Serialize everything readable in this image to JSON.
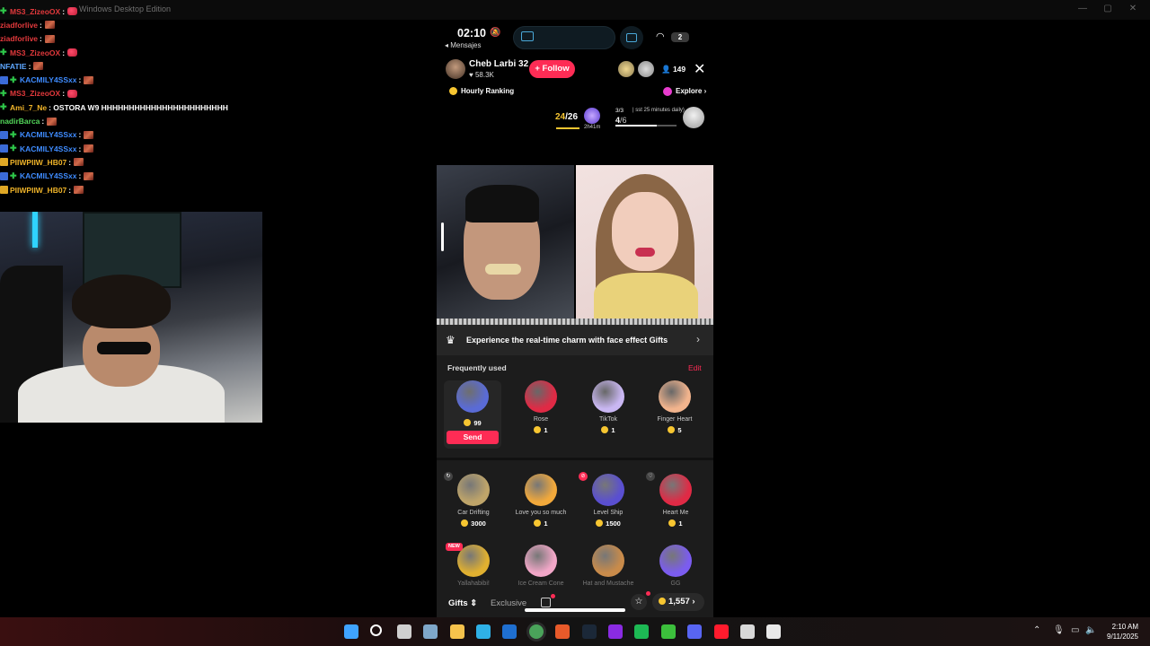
{
  "window": {
    "title": "Windows Desktop Edition"
  },
  "chat": [
    {
      "user": "MS3_ZizeoOX",
      "color": "#e3393c",
      "badge": "green",
      "text": ":",
      "emote": "heart"
    },
    {
      "user": "ziadforlive",
      "color": "#e3393c",
      "badge": "",
      "text": ":",
      "emote": "face"
    },
    {
      "user": "ziadforlive",
      "color": "#e3393c",
      "badge": "",
      "text": ":",
      "emote": "face"
    },
    {
      "user": "MS3_ZizeoOX",
      "color": "#e3393c",
      "badge": "green",
      "text": ":",
      "emote": "heart"
    },
    {
      "user": "NFATIE",
      "color": "#5ea7ff",
      "badge": "",
      "text": ":",
      "emote": "face"
    },
    {
      "user": "KACMILY4SSxx",
      "color": "#3f8cff",
      "badge": "blue",
      "text": ":",
      "emote": "face"
    },
    {
      "user": "MS3_ZizeoOX",
      "color": "#e3393c",
      "badge": "green",
      "text": ":",
      "emote": "heart"
    },
    {
      "user": "Ami_7_Ne",
      "color": "#f0b429",
      "badge": "green",
      "text": ": OSTORA W9 HHHHHHHHHHHHHHHHHHHHHHH",
      "emote": ""
    },
    {
      "user": "nadirBarca",
      "color": "#53d85a",
      "badge": "",
      "text": ":",
      "emote": "face"
    },
    {
      "user": "KACMILY4SSxx",
      "color": "#3f8cff",
      "badge": "blue",
      "text": ":",
      "emote": "face"
    },
    {
      "user": "KACMILY4SSxx",
      "color": "#3f8cff",
      "badge": "blue",
      "text": ":",
      "emote": "face"
    },
    {
      "user": "PIIWPIIW_HB07",
      "color": "#f0b429",
      "badge": "gold",
      "text": ":",
      "emote": "face"
    },
    {
      "user": "KACMILY4SSxx",
      "color": "#3f8cff",
      "badge": "blue",
      "text": ":",
      "emote": "face"
    },
    {
      "user": "PIIWPIIW_HB07",
      "color": "#f0b429",
      "badge": "gold",
      "text": ":",
      "emote": "face"
    }
  ],
  "phone": {
    "status": {
      "time": "02:10",
      "back_label": "◂ Mensajes",
      "battery": "2"
    },
    "host": {
      "name": "Cheb Larbi 32",
      "likes": "♥ 58.3K",
      "follow_label": "+ Follow",
      "viewers": "👤 149"
    },
    "ranking": {
      "label": "Hourly Ranking",
      "explore_label": "Explore ›"
    },
    "progress": {
      "count_current": "24",
      "count_total": "/26",
      "timer": "2h41m",
      "task_count": "3/3",
      "task_note": "| sst 25 minutes daily)",
      "task_sub_current": "4",
      "task_sub_total": "/6",
      "task_fill_fraction": 0.67
    },
    "banner": {
      "text": "Experience the real-time charm with face effect Gifts"
    },
    "frequently_used": {
      "title": "Frequently used",
      "edit_label": "Edit",
      "send_label": "Send",
      "gifts": [
        {
          "name": "",
          "price": "99",
          "selected": true,
          "color": "#5a6bd6"
        },
        {
          "name": "Rose",
          "price": "1",
          "color": "#e02a45"
        },
        {
          "name": "TikTok",
          "price": "1",
          "color": "#c9b7f2"
        },
        {
          "name": "Finger Heart",
          "price": "5",
          "color": "#f2b48d"
        }
      ]
    },
    "gift_grid": [
      {
        "name": "Car Drifting",
        "price": "3000",
        "color": "#bfa56a",
        "tag": "spin"
      },
      {
        "name": "Love you so much",
        "price": "1",
        "color": "#f2a93b",
        "tag": ""
      },
      {
        "name": "Level Ship",
        "price": "1500",
        "color": "#5a4fd1",
        "tag": "lock"
      },
      {
        "name": "Heart Me",
        "price": "1",
        "color": "#e02a45",
        "tag": "heart"
      },
      {
        "name": "Yallahabibi!",
        "price": "",
        "color": "#e0b030",
        "tag": "NEW"
      },
      {
        "name": "Ice Cream Cone",
        "price": "",
        "color": "#f2a7c8",
        "tag": ""
      },
      {
        "name": "Hat and Mustache",
        "price": "",
        "color": "#c98b4a",
        "tag": ""
      },
      {
        "name": "GG",
        "price": "",
        "color": "#7b5cf0",
        "tag": ""
      }
    ],
    "bottom": {
      "gifts_tab": "Gifts ⇕",
      "exclusive_tab": "Exclusive",
      "coins": "1,557 ›"
    }
  },
  "taskbar": {
    "time": "2:10 AM",
    "date": "9/11/2025",
    "icons": [
      "windows-icon",
      "search-icon",
      "task-view-icon",
      "settings-icon",
      "file-explorer-icon",
      "edge-icon",
      "outlook-icon",
      "chrome-icon",
      "office-icon",
      "steam-icon",
      "nzxt-icon",
      "spotify-icon",
      "game-icon",
      "discord-icon",
      "opera-icon",
      "app-icon",
      "snip-icon"
    ]
  }
}
